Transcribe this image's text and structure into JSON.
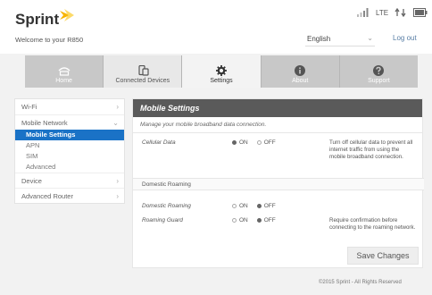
{
  "header": {
    "brand": "Sprint",
    "welcome": "Welcome to your R850",
    "network": "LTE",
    "language": "English",
    "logout": "Log out"
  },
  "nav": {
    "tabs": [
      {
        "label": "Home",
        "icon": "home-icon"
      },
      {
        "label": "Connected Devices",
        "icon": "devices-icon"
      },
      {
        "label": "Settings",
        "icon": "gear-icon"
      },
      {
        "label": "About",
        "icon": "info-icon"
      },
      {
        "label": "Support",
        "icon": "question-icon"
      }
    ],
    "active_index": 2
  },
  "sidebar": {
    "items": [
      {
        "label": "Wi-Fi"
      },
      {
        "label": "Mobile Network"
      },
      {
        "label": "Device"
      },
      {
        "label": "Advanced Router"
      }
    ],
    "subitems": [
      "Mobile Settings",
      "APN",
      "SIM",
      "Advanced"
    ]
  },
  "panel": {
    "title": "Mobile Settings",
    "subtitle": "Manage your mobile broadband data connection.",
    "cellular": {
      "label": "Cellular Data",
      "on": "ON",
      "off": "OFF",
      "value": "ON",
      "desc": "Turn off cellular data to prevent all internet traffic from using the mobile broadband connection."
    },
    "domestic_section": "Domestic Roaming",
    "domestic": {
      "label": "Domestic Roaming",
      "on": "ON",
      "off": "OFF",
      "value": "OFF"
    },
    "guard": {
      "label": "Roaming Guard",
      "on": "ON",
      "off": "OFF",
      "value": "OFF",
      "desc": "Require confirmation before connecting to the roaming network."
    },
    "save": "Save Changes"
  },
  "footer": "©2015 Sprint - All Rights Reserved",
  "colors": {
    "accent": "#1a72c6",
    "header_bar": "#5a5a5a",
    "brand_yellow": "#f7b500"
  }
}
